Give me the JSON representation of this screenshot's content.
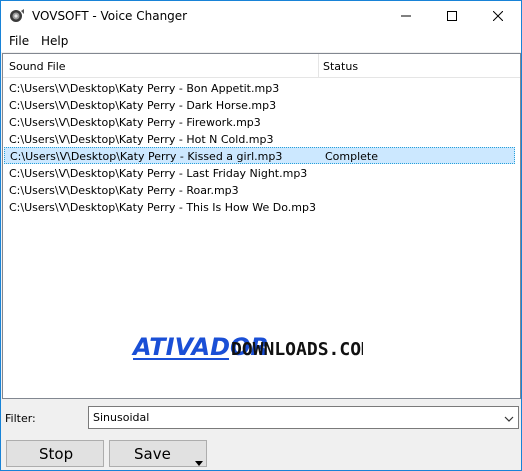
{
  "window": {
    "title": "VOVSOFT - Voice Changer",
    "border_color": "#1883d7"
  },
  "menu": {
    "items": [
      {
        "label": "File"
      },
      {
        "label": "Help"
      }
    ]
  },
  "list": {
    "columns": [
      "Sound File",
      "Status"
    ],
    "rows": [
      {
        "file": "C:\\Users\\V\\Desktop\\Katy Perry - Bon Appetit.mp3",
        "status": ""
      },
      {
        "file": "C:\\Users\\V\\Desktop\\Katy Perry - Dark Horse.mp3",
        "status": ""
      },
      {
        "file": "C:\\Users\\V\\Desktop\\Katy Perry - Firework.mp3",
        "status": ""
      },
      {
        "file": "C:\\Users\\V\\Desktop\\Katy Perry - Hot N Cold.mp3",
        "status": ""
      },
      {
        "file": "C:\\Users\\V\\Desktop\\Katy Perry - Kissed a girl.mp3",
        "status": "Complete",
        "selected": true
      },
      {
        "file": "C:\\Users\\V\\Desktop\\Katy Perry - Last Friday Night.mp3",
        "status": ""
      },
      {
        "file": "C:\\Users\\V\\Desktop\\Katy Perry - Roar.mp3",
        "status": ""
      },
      {
        "file": "C:\\Users\\V\\Desktop\\Katy Perry - This Is How We Do.mp3",
        "status": ""
      }
    ],
    "selection_color": "#cce8ff"
  },
  "watermark": {
    "text_a": "ATIVADOR",
    "text_b": "DOWNLOADS.COM",
    "color_a": "#1a4fd6",
    "color_b": "#111111"
  },
  "filter": {
    "label": "Filter:",
    "value": "Sinusoidal"
  },
  "buttons": {
    "stop": "Stop",
    "save": "Save"
  },
  "icons": {
    "app": "speaker-icon",
    "minimize": "minimize-icon",
    "maximize": "maximize-icon",
    "close": "close-icon",
    "dropdown": "chevron-down-icon"
  }
}
